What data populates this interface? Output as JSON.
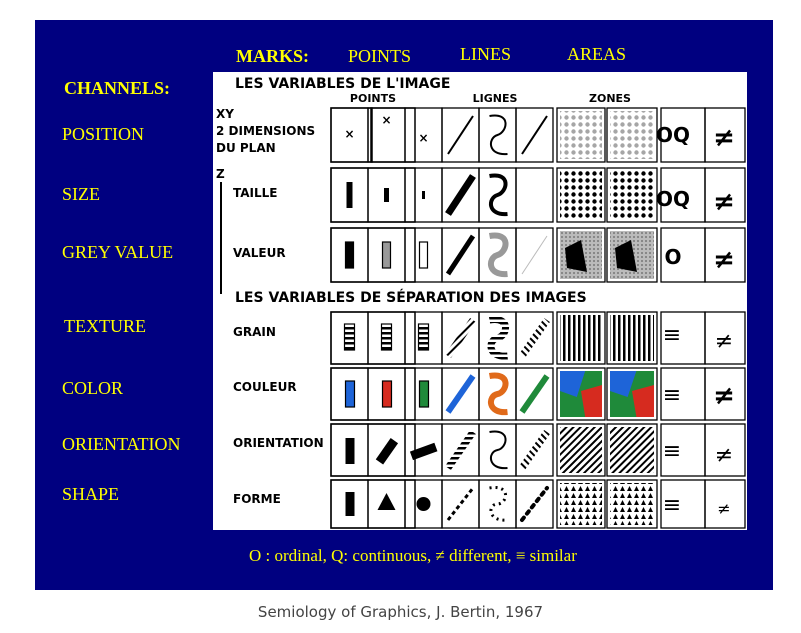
{
  "header": {
    "marks_label": "MARKS:",
    "marks": [
      "POINTS",
      "LINES",
      "AREAS"
    ],
    "channels_label": "CHANNELS:"
  },
  "channels": [
    "POSITION",
    "SIZE",
    "GREY VALUE",
    "TEXTURE",
    "COLOR",
    "ORIENTATION",
    "SHAPE"
  ],
  "figure": {
    "title_image": "LES VARIABLES DE L'IMAGE",
    "title_separation": "LES VARIABLES DE SÉPARATION DES IMAGES",
    "col_points": "POINTS",
    "col_lines": "LIGNES",
    "col_zones": "ZONES",
    "row_xy_tag": "XY",
    "row_xy_line1": "2 DIMENSIONS",
    "row_xy_line2": "DU PLAN",
    "row_z_tag": "Z",
    "rows": [
      "TAILLE",
      "VALEUR",
      "GRAIN",
      "COULEUR",
      "ORIENTATION",
      "FORME"
    ],
    "prop_oq": "OQ",
    "prop_o": "O",
    "prop_neq": "≠",
    "prop_equiv": "≡",
    "colors": {
      "blue": "#1e64d8",
      "red": "#d62b1f",
      "green": "#1f8a3a",
      "orange": "#e06a1a",
      "yellow": "#ffff00",
      "navy": "#000080"
    }
  },
  "legend": "O : ordinal, Q: continuous, ≠ different, ≡ similar",
  "caption": "Semiology of Graphics, J. Bertin, 1967"
}
